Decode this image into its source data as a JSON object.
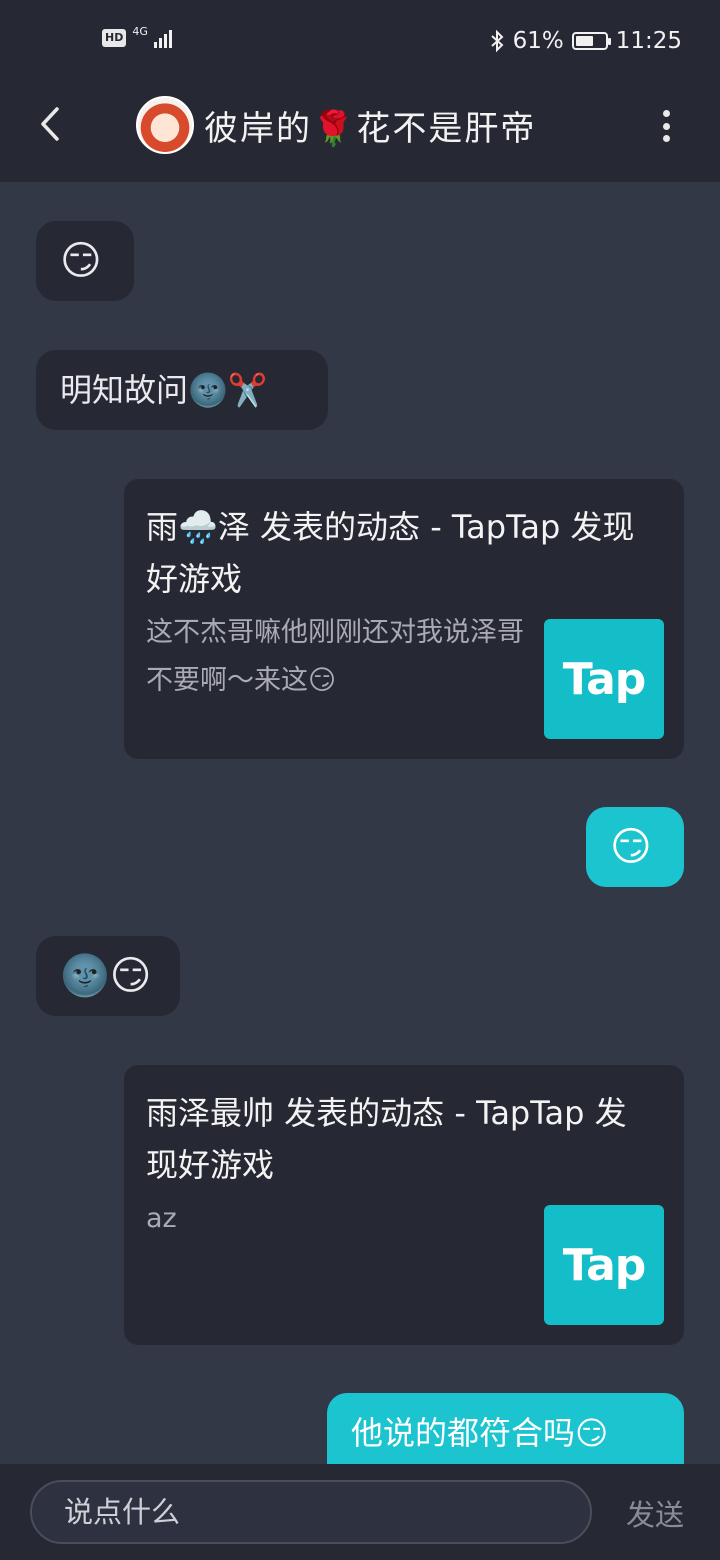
{
  "status_bar": {
    "hd": "HD",
    "network": "4G",
    "battery_percent": "61%",
    "battery_level": 0.61,
    "time": "11:25"
  },
  "header": {
    "title": "彼岸的🌹花不是肝帝"
  },
  "messages": [
    {
      "side": "in",
      "type": "text",
      "text": "😏"
    },
    {
      "side": "in",
      "type": "text",
      "text": "明知故问🌚✂️"
    },
    {
      "side": "out",
      "type": "card",
      "title": "雨🌧️泽 发表的动态 - TapTap 发现好游戏",
      "body": "这不杰哥嘛他刚刚还对我说泽哥不要啊～来这😏",
      "logo": "Tap"
    },
    {
      "side": "out",
      "type": "text",
      "text": "😏"
    },
    {
      "side": "in",
      "type": "text",
      "text": "🌚😏"
    },
    {
      "side": "out",
      "type": "card",
      "title": "雨泽最帅 发表的动态 - TapTap 发现好游戏",
      "body": "az",
      "logo": "Tap"
    },
    {
      "side": "out",
      "type": "text",
      "text": "他说的都符合吗😏"
    }
  ],
  "input": {
    "placeholder": "说点什么",
    "send_label": "发送"
  },
  "colors": {
    "background": "#333846",
    "bar": "#262833",
    "incoming_bubble": "#262833",
    "outgoing_bubble": "#1bc4cf",
    "tap_logo": "#14bec9"
  }
}
